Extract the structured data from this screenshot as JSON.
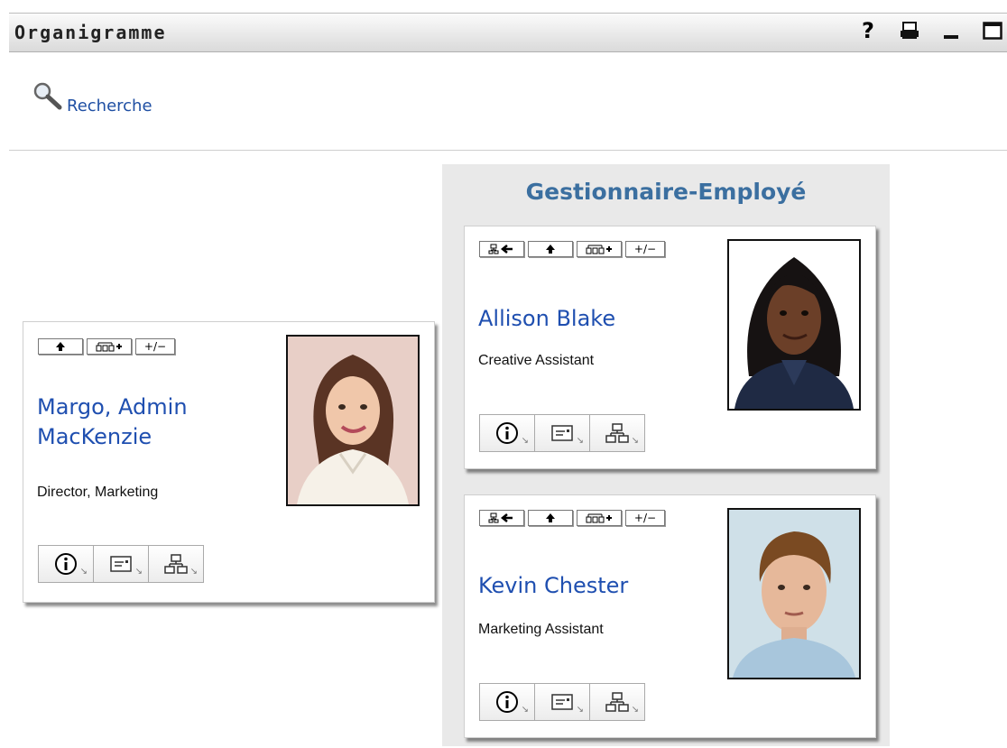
{
  "window": {
    "title": "Organigramme",
    "icons": [
      "help-icon",
      "print-icon",
      "minimize-icon",
      "maximize-icon"
    ],
    "help_glyph": "?"
  },
  "search": {
    "label": "Recherche",
    "icon": "search-icon"
  },
  "manager": {
    "name_line1": "Margo, Admin",
    "name_line2": "MacKenzie",
    "job_title": "Director, Marketing",
    "toggle_label": "+/−",
    "buttons": [
      "up-arrow-icon",
      "expand-reports-icon",
      "toggle-button"
    ],
    "actions": [
      "info-icon",
      "vcard-icon",
      "org-chart-icon"
    ]
  },
  "panel": {
    "title": "Gestionnaire-Employé"
  },
  "employees": [
    {
      "name": "Allison Blake",
      "job_title": "Creative Assistant",
      "toggle_label": "+/−"
    },
    {
      "name": "Kevin Chester",
      "job_title": "Marketing Assistant",
      "toggle_label": "+/−"
    }
  ],
  "colors": {
    "link": "#1f4fb0",
    "panel_title": "#3b6fa0",
    "panel_bg": "#e9e9e9"
  }
}
